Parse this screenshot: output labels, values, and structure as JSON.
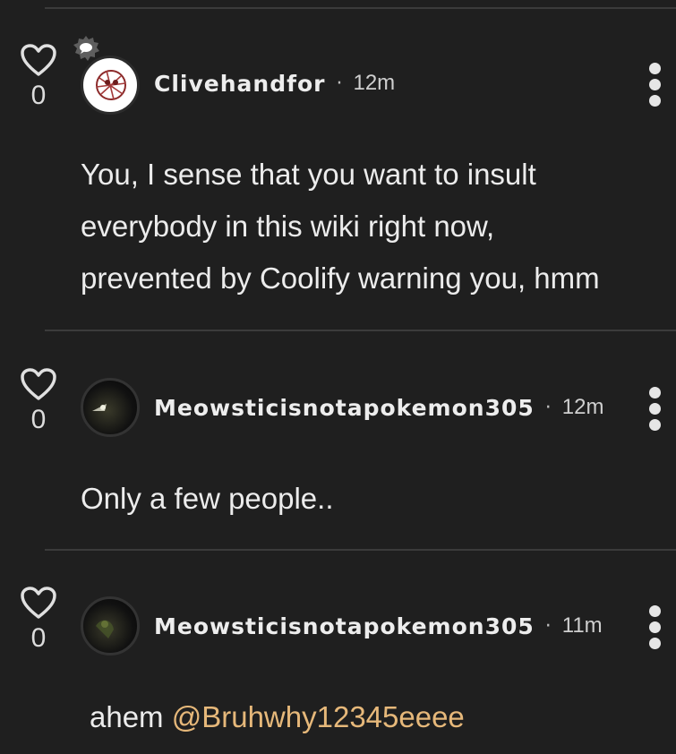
{
  "comments": [
    {
      "username": "Clivehandfor",
      "separator": "·",
      "time": "12m",
      "likes": "0",
      "lines": [
        "You, I sense that you want to insult",
        "everybody in this wiki right now,",
        "prevented by Coolify warning you, hmm"
      ],
      "avatar_icon": "character-drawing-avatar",
      "badge_icon": "discussion-badge-icon"
    },
    {
      "username": "Meowsticisnotapokemon305",
      "separator": "·",
      "time": "12m",
      "likes": "0",
      "text": "Only a few people..",
      "avatar_icon": "dark-photo-avatar"
    },
    {
      "username": "Meowsticisnotapokemon305",
      "separator": "·",
      "time": "11m",
      "likes": "0",
      "text_prefix": "ahem ",
      "mention": "@Bruhwhy12345eeee",
      "avatar_icon": "dark-photo-avatar"
    }
  ],
  "colors": {
    "background": "#1f1f1f",
    "text": "#ececec",
    "mention": "#e6b87a",
    "divider": "#3b3b3b"
  }
}
